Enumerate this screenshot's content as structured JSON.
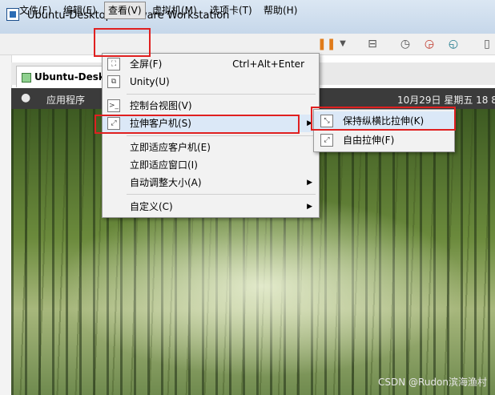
{
  "window": {
    "title": "Ubuntu-Desktop - VMware Workstation"
  },
  "menubar": {
    "items": [
      "文件(F)",
      "编辑(E)",
      "查看(V)",
      "虚拟机(M)",
      "选项卡(T)",
      "帮助(H)"
    ]
  },
  "toolbar": {
    "icons": [
      "pause-icon",
      "dropdown-icon",
      "network-icon",
      "snapshot-icon",
      "revert-snapshot-icon",
      "snapshot-manager-icon",
      "view-icon"
    ]
  },
  "tabs": {
    "vm_tab": "Ubuntu-Deskt"
  },
  "guest": {
    "apps": "应用程序",
    "clock": "10月29日 星期五  18 8"
  },
  "view_menu": {
    "items": [
      {
        "label": "全屏(F)",
        "shortcut": "Ctrl+Alt+Enter"
      },
      {
        "label": "Unity(U)",
        "shortcut": ""
      },
      {
        "label": "控制台视图(V)",
        "shortcut": ""
      },
      {
        "label": "拉伸客户机(S)",
        "shortcut": ""
      },
      {
        "label": "立即适应客户机(E)",
        "shortcut": ""
      },
      {
        "label": "立即适应窗口(I)",
        "shortcut": ""
      },
      {
        "label": "自动调整大小(A)",
        "shortcut": ""
      },
      {
        "label": "自定义(C)",
        "shortcut": ""
      }
    ]
  },
  "stretch_submenu": {
    "items": [
      {
        "label": "保持纵横比拉伸(K)"
      },
      {
        "label": "自由拉伸(F)"
      }
    ]
  },
  "watermark": "CSDN @Rudon滨海渔村",
  "colors": {
    "highlight_box": "#e02020",
    "menu_hover": "#dbe8f7"
  }
}
